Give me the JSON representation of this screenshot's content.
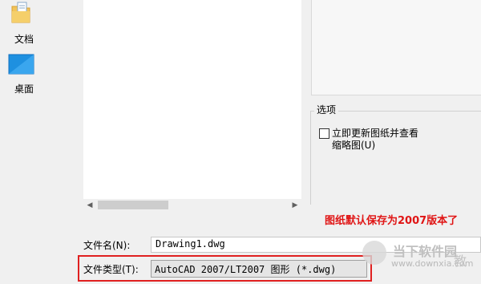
{
  "places": {
    "items": [
      {
        "label": "文档",
        "icon": "documents-folder-icon"
      },
      {
        "label": "桌面",
        "icon": "desktop-icon"
      }
    ]
  },
  "options": {
    "group_title": "选项",
    "checkbox_line1": "立即更新图纸并查看",
    "checkbox_line2": "缩略图(U)",
    "checked": false
  },
  "annotation": "图纸默认保存为2007版本了",
  "filename": {
    "label": "文件名(N):",
    "value": "Drawing1.dwg"
  },
  "filetype": {
    "label": "文件类型(T):",
    "value": "AutoCAD 2007/LT2007 图形 (*.dwg)"
  },
  "watermark": {
    "brand": "当下软件园",
    "url": "www.downxia.com",
    "side": "教"
  },
  "colors": {
    "accent_red": "#e01515",
    "folder": "#f2c45a",
    "desktop": "#1e90e0"
  }
}
